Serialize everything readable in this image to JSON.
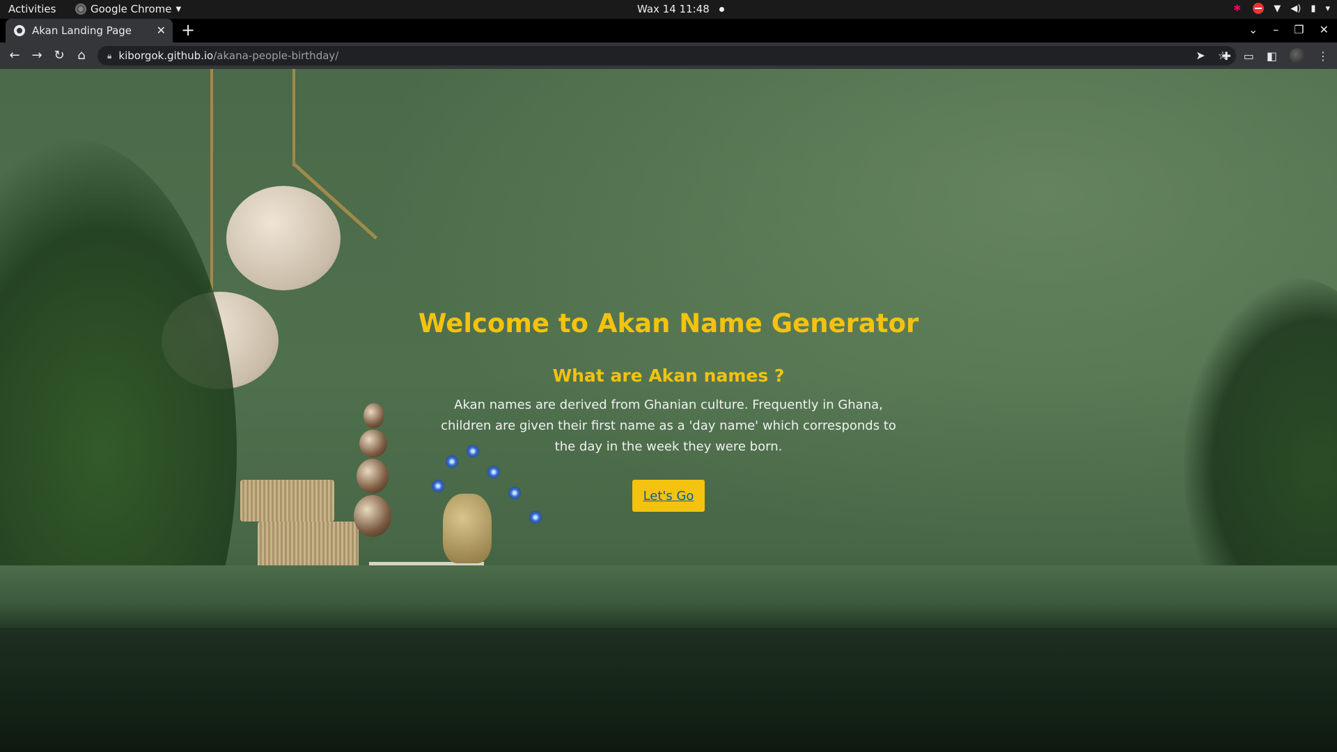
{
  "system_bar": {
    "activities_label": "Activities",
    "app_name": "Google Chrome",
    "clock": "Wax 14  11:48"
  },
  "browser": {
    "tab": {
      "title": "Akan Landing Page"
    },
    "address": {
      "host": "kiborgok.github.io",
      "path": "/akana-people-birthday/"
    }
  },
  "page": {
    "title": "Welcome to Akan Name Generator",
    "subtitle": "What are Akan names ?",
    "description": "Akan names are derived from Ghanian culture. Frequently in Ghana, children are given their first name as a 'day name' which corresponds to the day in the week they were born.",
    "cta_label": "Let's Go",
    "accent_color": "#f3c30f",
    "background_color": "#4f704d"
  }
}
